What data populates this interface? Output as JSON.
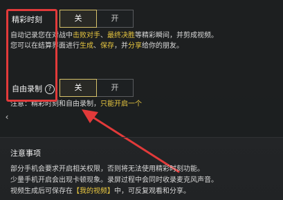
{
  "highlight_moment": {
    "label": "精彩时刻",
    "options": [
      "关",
      "开"
    ],
    "selected": "关",
    "description_line1": {
      "prefix": "自动记录您在对战中",
      "hl1": "击败对手",
      "mid": "、",
      "hl2": "最终决胜",
      "suffix": "等精彩瞬间，并剪成视频。"
    },
    "description_line2": {
      "prefix": "您可以在结算界面进行",
      "hl1": "生成",
      "mid1": "、",
      "hl2": "保存",
      "mid2": "，并",
      "hl3": "分享",
      "suffix": "给你的朋友。"
    }
  },
  "free_record": {
    "label": "自由录制",
    "help_icon": "question-circle-icon",
    "options": [
      "关",
      "开"
    ],
    "selected": "关",
    "note_prefix": "注意：精彩时刻和自由录制，",
    "note_highlight": "只能开启一个"
  },
  "notes": {
    "title": "注意事项",
    "line1": "部分手机会要求开启相关权限，否则将无法使用精彩时刻功能。",
    "line2": "少量手机开启会出现卡顿现象。录屏过程中会同时收录麦克风声音。",
    "line3_prefix": "视频生成后可保存在",
    "line3_highlight": "【我的视频】",
    "line3_suffix": "中，可反复观看和分享。"
  },
  "annotations": {
    "box_color": "#e23a3a",
    "arrow_color": "#e23a3a"
  },
  "colors": {
    "accent_yellow": "#e8c740",
    "active_border": "#d8c36b",
    "text": "#e9e9e9"
  }
}
